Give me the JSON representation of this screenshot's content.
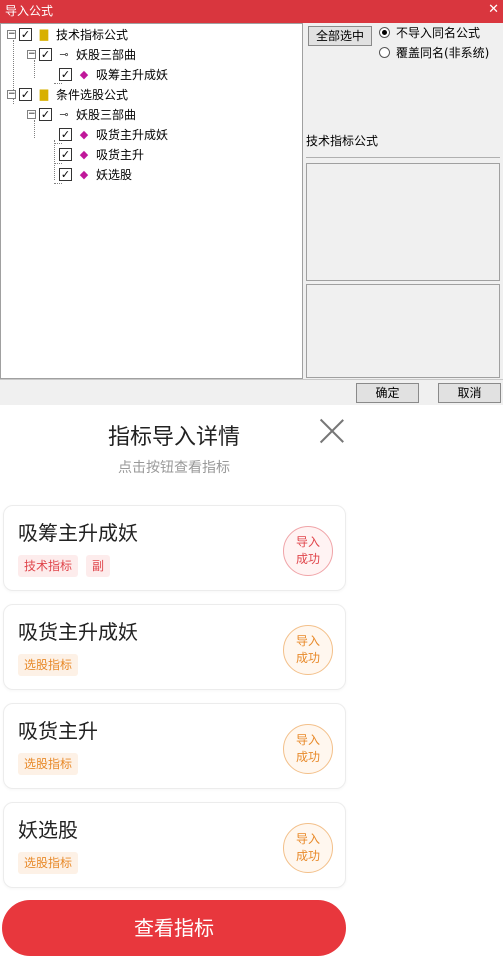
{
  "window": {
    "title": "导入公式",
    "close_glyph": "✕"
  },
  "tree": {
    "nodes": [
      {
        "level": 0,
        "expander": "−",
        "checked": true,
        "icon": "folder-icon",
        "label": "技术指标公式"
      },
      {
        "level": 1,
        "expander": "−",
        "checked": true,
        "icon": "key-icon",
        "label": "妖股三部曲"
      },
      {
        "level": 2,
        "expander": "",
        "checked": true,
        "icon": "formula-icon",
        "label": "吸筹主升成妖"
      },
      {
        "level": 0,
        "expander": "−",
        "checked": true,
        "icon": "folder-icon",
        "label": "条件选股公式"
      },
      {
        "level": 1,
        "expander": "−",
        "checked": true,
        "icon": "key-icon",
        "label": "妖股三部曲"
      },
      {
        "level": 2,
        "expander": "",
        "checked": true,
        "icon": "formula-icon",
        "label": "吸货主升成妖"
      },
      {
        "level": 2,
        "expander": "",
        "checked": true,
        "icon": "formula-icon",
        "label": "吸货主升"
      },
      {
        "level": 2,
        "expander": "",
        "checked": true,
        "icon": "formula-icon",
        "label": "妖选股"
      }
    ]
  },
  "options": {
    "select_all_label": "全部选中",
    "radio_no_import": "不导入同名公式",
    "radio_overwrite": "覆盖同名(非系统)",
    "selected_radio": "no_import",
    "section_label": "技术指标公式"
  },
  "footer": {
    "ok_label": "确定",
    "cancel_label": "取消"
  },
  "mobile": {
    "title": "指标导入详情",
    "subtitle": "点击按钮查看指标",
    "cards": [
      {
        "name": "吸筹主升成妖",
        "tags": [
          {
            "text": "技术指标",
            "tone": "red"
          },
          {
            "text": "副",
            "tone": "red"
          }
        ],
        "status": [
          "导入",
          "成功"
        ],
        "tone": "red"
      },
      {
        "name": "吸货主升成妖",
        "tags": [
          {
            "text": "选股指标",
            "tone": "orange"
          }
        ],
        "status": [
          "导入",
          "成功"
        ],
        "tone": "orange"
      },
      {
        "name": "吸货主升",
        "tags": [
          {
            "text": "选股指标",
            "tone": "orange"
          }
        ],
        "status": [
          "导入",
          "成功"
        ],
        "tone": "orange"
      },
      {
        "name": "妖选股",
        "tags": [
          {
            "text": "选股指标",
            "tone": "orange"
          }
        ],
        "status": [
          "导入",
          "成功"
        ],
        "tone": "orange"
      }
    ],
    "cta_label": "查看指标"
  },
  "colors": {
    "titlebar": "#d9363e",
    "accent_red": "#e8373d",
    "tag_red": "#e0464c",
    "tag_orange": "#e88a2a"
  }
}
